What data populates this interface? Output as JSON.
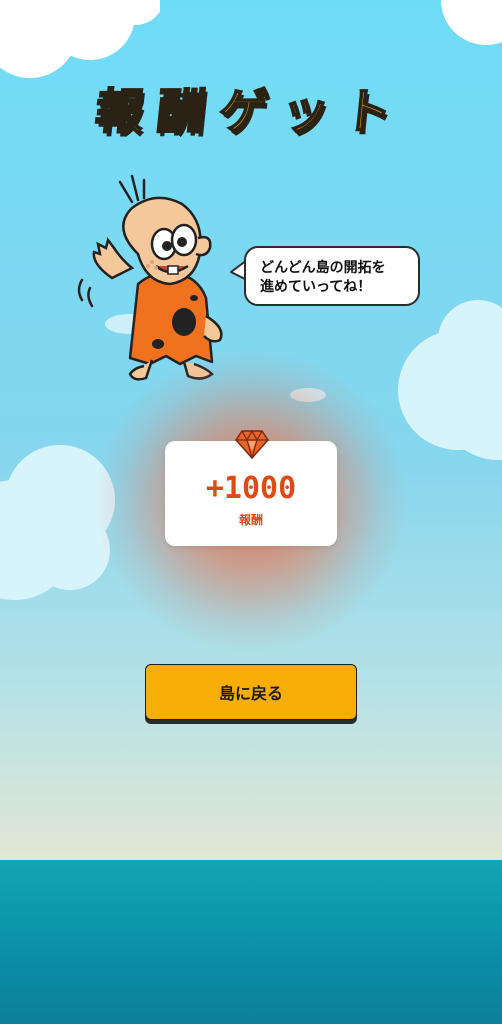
{
  "header": {
    "title": "報酬ゲット"
  },
  "character": {
    "speech_line1": "どんどん島の開拓を",
    "speech_line2": "進めていってね！"
  },
  "reward": {
    "amount": "+1000",
    "label": "報酬",
    "icon": "gem-icon",
    "color": "#e04a17"
  },
  "actions": {
    "return_label": "島に戻る",
    "button_color": "#f8ad07"
  }
}
